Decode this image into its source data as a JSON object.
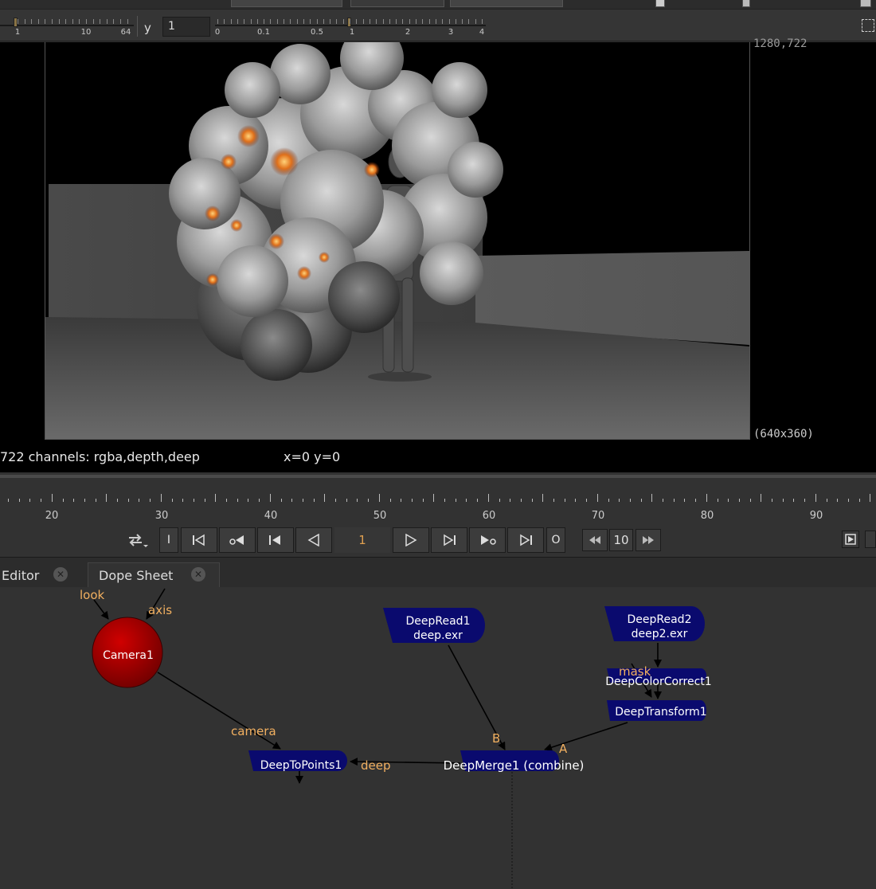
{
  "toolbar": {
    "y_label": "y",
    "y_value": "1",
    "slider1_ticks": [
      "1",
      "10",
      "64"
    ],
    "slider2_ticks": [
      "0",
      "0.1",
      "0.5",
      "1",
      "2",
      "3",
      "4"
    ]
  },
  "viewer": {
    "resolution_top": "1280,722",
    "resolution_bottom": "(640x360)"
  },
  "info": {
    "channels": "722 channels: rgba,depth,deep",
    "coords": "x=0 y=0"
  },
  "timeline": {
    "labels": [
      "20",
      "30",
      "40",
      "50",
      "60",
      "70",
      "80",
      "90"
    ],
    "current_frame": "1",
    "step": "10",
    "in_label": "I",
    "out_label": "O"
  },
  "tabs": [
    {
      "label": "Editor"
    },
    {
      "label": "Dope Sheet"
    }
  ],
  "nodes": {
    "camera": {
      "name": "Camera1",
      "input_look": "look",
      "input_axis": "axis"
    },
    "deepread1": {
      "name": "DeepRead1",
      "file": "deep.exr"
    },
    "deepread2": {
      "name": "DeepRead2",
      "file": "deep2.exr"
    },
    "deepcolorcorrect": {
      "name": "DeepColorCorrect1",
      "input_mask": "mask"
    },
    "deeptransform": {
      "name": "DeepTransform1"
    },
    "deepmerge": {
      "name": "DeepMerge1 (combine)",
      "input_b": "B",
      "input_a": "A"
    },
    "deeptopoints": {
      "name": "DeepToPoints1",
      "input_camera": "camera",
      "input_deep": "deep"
    }
  },
  "colors": {
    "node_deep": "#0a0a6e",
    "camera_node": "#b00000",
    "pipe_label": "#f2b060",
    "frame_number": "#e0a050"
  }
}
